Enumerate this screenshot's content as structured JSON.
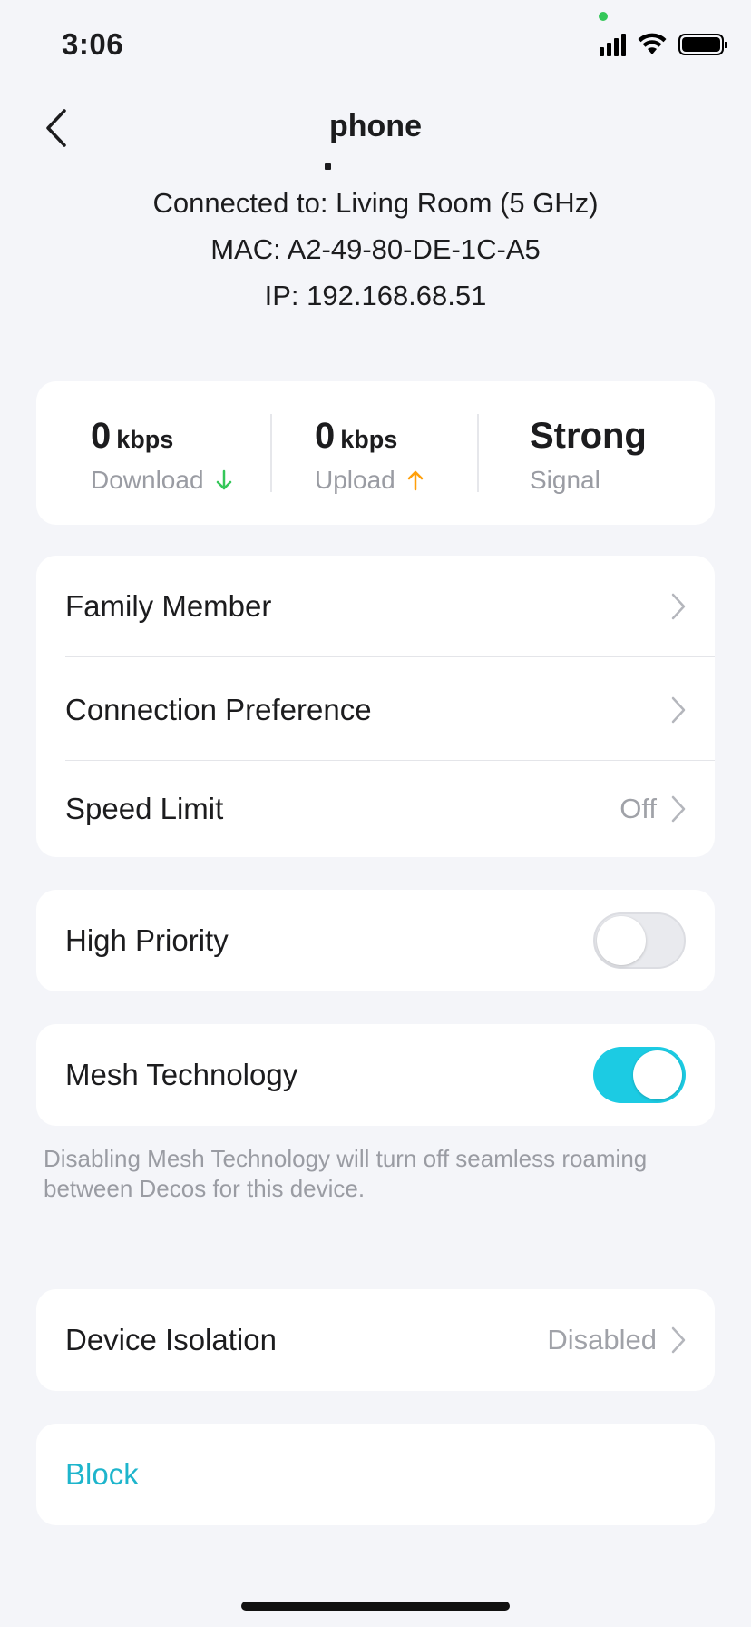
{
  "status_bar": {
    "time": "3:06"
  },
  "header": {
    "title": "phone"
  },
  "device_info": {
    "connected_to": "Connected to: Living Room (5 GHz)",
    "mac": "MAC: A2-49-80-DE-1C-A5",
    "ip": "IP: 192.168.68.51"
  },
  "stats": {
    "download": {
      "value": "0",
      "unit": "kbps",
      "label": "Download",
      "arrow_color": "#34c759"
    },
    "upload": {
      "value": "0",
      "unit": "kbps",
      "label": "Upload",
      "arrow_color": "#ff9f0a"
    },
    "signal": {
      "value": "Strong",
      "label": "Signal"
    }
  },
  "settings": {
    "family_member": {
      "label": "Family Member"
    },
    "connection_preference": {
      "label": "Connection Preference"
    },
    "speed_limit": {
      "label": "Speed Limit",
      "value": "Off"
    },
    "high_priority": {
      "label": "High Priority",
      "enabled": false
    },
    "mesh_technology": {
      "label": "Mesh Technology",
      "enabled": true,
      "note": "Disabling Mesh Technology will turn off seamless roaming between Decos for this device."
    },
    "device_isolation": {
      "label": "Device Isolation",
      "value": "Disabled"
    }
  },
  "actions": {
    "block_label": "Block"
  },
  "colors": {
    "accent": "#1ccbe3",
    "link": "#1eb5cc",
    "background": "#f4f5f9"
  }
}
